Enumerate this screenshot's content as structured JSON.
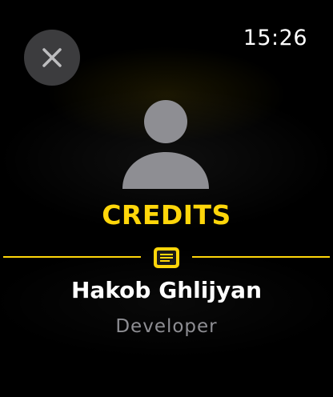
{
  "status_bar": {
    "time": "15:26"
  },
  "header": {
    "close_icon": "close-icon"
  },
  "main": {
    "avatar_icon": "person-icon",
    "title": "CREDITS",
    "divider_icon": "notes-icon",
    "name": "Hakob Ghlijyan",
    "role": "Developer"
  },
  "colors": {
    "accent": "#ffd60a",
    "secondary_text": "#8e8e93",
    "button_background": "#3c3c3e"
  }
}
